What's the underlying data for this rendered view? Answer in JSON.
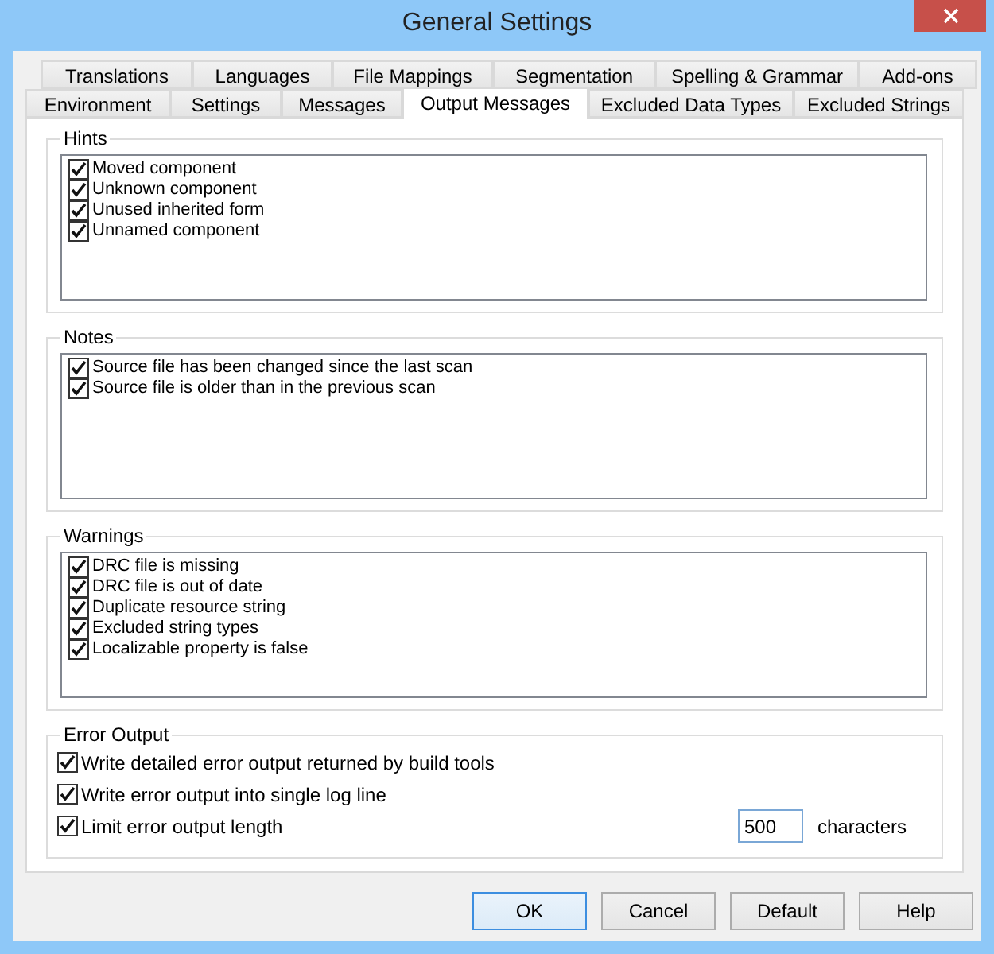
{
  "window": {
    "title": "General Settings"
  },
  "tab_rows": [
    {
      "tabs": [
        {
          "label": "Translations",
          "selected": false
        },
        {
          "label": "Languages",
          "selected": false
        },
        {
          "label": "File Mappings",
          "selected": false
        },
        {
          "label": "Segmentation",
          "selected": false
        },
        {
          "label": "Spelling & Grammar",
          "selected": false
        },
        {
          "label": "Add-ons",
          "selected": false
        }
      ]
    },
    {
      "tabs": [
        {
          "label": "Environment",
          "selected": false
        },
        {
          "label": "Settings",
          "selected": false
        },
        {
          "label": "Messages",
          "selected": false
        },
        {
          "label": "Output Messages",
          "selected": true
        },
        {
          "label": "Excluded Data Types",
          "selected": false
        },
        {
          "label": "Excluded Strings",
          "selected": false
        }
      ]
    }
  ],
  "groups": [
    {
      "title": "Hints",
      "items": [
        {
          "label": "Moved component",
          "checked": true
        },
        {
          "label": "Unknown component",
          "checked": true
        },
        {
          "label": "Unused inherited form",
          "checked": true
        },
        {
          "label": "Unnamed component",
          "checked": true
        }
      ]
    },
    {
      "title": "Notes",
      "items": [
        {
          "label": "Source file has been changed since the last scan",
          "checked": true
        },
        {
          "label": "Source file is older than in the previous scan",
          "checked": true
        }
      ]
    },
    {
      "title": "Warnings",
      "items": [
        {
          "label": "DRC file is missing",
          "checked": true
        },
        {
          "label": "DRC file is out of date",
          "checked": true
        },
        {
          "label": "Duplicate resource string",
          "checked": true
        },
        {
          "label": "Excluded string types",
          "checked": true
        },
        {
          "label": "Localizable property is false",
          "checked": true
        }
      ]
    }
  ],
  "error_output": {
    "title": "Error Output",
    "options": [
      {
        "label": "Write detailed error output returned by build tools",
        "checked": true
      },
      {
        "label": "Write error output into single log line",
        "checked": true
      },
      {
        "label": "Limit error output length",
        "checked": true
      }
    ],
    "length_field": {
      "value": "500"
    },
    "units": "characters"
  },
  "buttons": [
    {
      "label": "OK",
      "default": true
    },
    {
      "label": "Cancel",
      "default": false
    },
    {
      "label": "Default",
      "default": false
    },
    {
      "label": "Help",
      "default": false
    }
  ]
}
